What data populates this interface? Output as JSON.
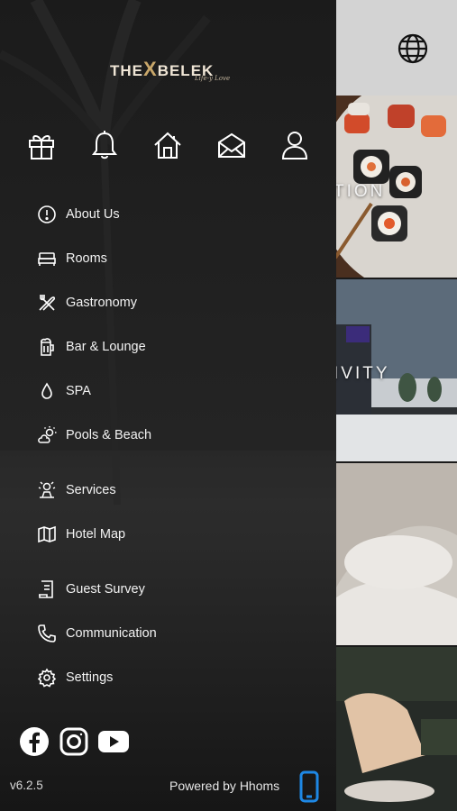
{
  "background": {
    "tiles": [
      {
        "label": "TION"
      },
      {
        "label": "IVITY"
      },
      {
        "label": ""
      },
      {
        "label": ""
      }
    ]
  },
  "drawer": {
    "logo": {
      "brand_left": "THE",
      "brand_x": "X",
      "brand_right": "BELEK",
      "tagline": "Life-y Love"
    },
    "quick_icons": [
      "gift-icon",
      "bell-icon",
      "home-icon",
      "mail-icon",
      "user-icon"
    ],
    "menu": {
      "items": [
        {
          "label": "About Us",
          "icon": "info-icon"
        },
        {
          "label": "Rooms",
          "icon": "bed-icon"
        },
        {
          "label": "Gastronomy",
          "icon": "utensils-icon"
        },
        {
          "label": "Bar & Lounge",
          "icon": "beer-icon"
        },
        {
          "label": "SPA",
          "icon": "water-drop-icon"
        },
        {
          "label": "Pools & Beach",
          "icon": "sun-cloud-icon"
        },
        {
          "label": "Services",
          "icon": "services-icon"
        },
        {
          "label": "Hotel Map",
          "icon": "map-icon"
        },
        {
          "label": "Guest Survey",
          "icon": "survey-icon"
        },
        {
          "label": "Communication",
          "icon": "phone-call-icon"
        },
        {
          "label": "Settings",
          "icon": "gear-icon"
        }
      ]
    },
    "social": [
      "facebook-icon",
      "instagram-icon",
      "youtube-icon"
    ],
    "footer": {
      "version": "v6.2.5",
      "powered_by": "Powered by Hhoms"
    }
  },
  "colors": {
    "drawer_bg": "#171717",
    "accent_phone": "#1e88e5",
    "header_bg": "#d3d3d3",
    "logo_gold": "#c9a76a"
  }
}
